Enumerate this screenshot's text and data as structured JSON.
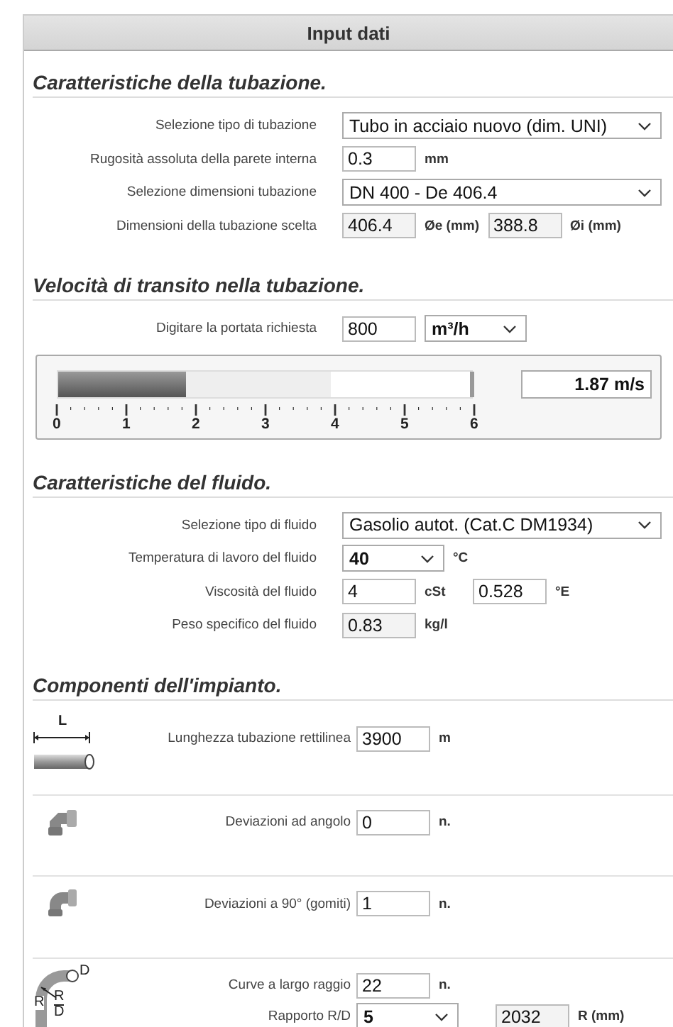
{
  "header": {
    "title": "Input dati"
  },
  "pipe": {
    "title": "Caratteristiche della tubazione.",
    "rows": [
      {
        "label": "Selezione tipo di tubazione",
        "controls": [
          {
            "kind": "select",
            "value": "Tubo in acciaio nuovo (dim. UNI)"
          }
        ]
      },
      {
        "label": "Rugosità assoluta della parete interna",
        "controls": [
          {
            "kind": "input",
            "value": "0.3",
            "disabled": false
          },
          {
            "kind": "unit",
            "text": "mm"
          }
        ]
      },
      {
        "label": "Selezione dimensioni tubazione",
        "controls": [
          {
            "kind": "select",
            "value": "DN 400 - De 406.4"
          }
        ]
      },
      {
        "label": "Dimensioni della tubazione scelta",
        "controls": [
          {
            "kind": "input",
            "value": "406.4",
            "disabled": true
          },
          {
            "kind": "unit",
            "text": "Øe (mm)"
          },
          {
            "kind": "input",
            "value": "388.8",
            "disabled": true
          },
          {
            "kind": "unit",
            "text": "Øi (mm)"
          }
        ]
      }
    ]
  },
  "velocity": {
    "title": "Velocità di transito nella tubazione.",
    "rows": [
      {
        "label": "Digitare la portata richiesta",
        "controls": [
          {
            "kind": "input",
            "value": "800",
            "disabled": false
          },
          {
            "kind": "compact-select",
            "value": "m³/h"
          }
        ]
      }
    ],
    "gauge": {
      "level": 0.31,
      "reading": "1.87 m/s",
      "ticks": [
        "0",
        "1",
        "2",
        "3",
        "4",
        "5",
        "6"
      ]
    }
  },
  "fluid": {
    "title": "Caratteristiche del fluido.",
    "rows": [
      {
        "label": "Selezione tipo di fluido",
        "controls": [
          {
            "kind": "select",
            "value": "Gasolio autot. (Cat.C DM1934)"
          }
        ]
      },
      {
        "label": "Temperatura di lavoro del fluido",
        "controls": [
          {
            "kind": "compact-select",
            "value": "40"
          },
          {
            "kind": "unit",
            "text": "°C"
          }
        ]
      },
      {
        "label": "Viscosità del fluido",
        "controls": [
          {
            "kind": "input",
            "value": "4",
            "disabled": false
          },
          {
            "kind": "unit",
            "text": "cSt"
          },
          {
            "kind": "input",
            "value": "0.528",
            "disabled": false
          },
          {
            "kind": "unit",
            "text": "°E"
          }
        ]
      },
      {
        "label": "Peso specifico del fluido",
        "controls": [
          {
            "kind": "input",
            "value": "0.83",
            "disabled": true
          },
          {
            "kind": "unit",
            "text": "kg/l"
          }
        ]
      }
    ]
  },
  "components": {
    "title": "Componenti dell'impianto.",
    "groups": [
      {
        "kind": "straight-pipe",
        "icon_texts": [
          "L"
        ],
        "rows": [
          {
            "label": "Lunghezza tubazione rettilinea",
            "controls": [
              {
                "kind": "input",
                "value": "3900",
                "disabled": false
              },
              {
                "kind": "unit",
                "text": "m"
              }
            ]
          }
        ]
      },
      {
        "kind": "angle-fitting",
        "rows": [
          {
            "label": "Deviazioni ad angolo",
            "controls": [
              {
                "kind": "input",
                "value": "0",
                "disabled": false
              },
              {
                "kind": "unit",
                "text": "n."
              }
            ]
          }
        ]
      },
      {
        "kind": "elbow",
        "rows": [
          {
            "label": "Deviazioni a 90° (gomiti)",
            "controls": [
              {
                "kind": "input",
                "value": "1",
                "disabled": false
              },
              {
                "kind": "unit",
                "text": "n."
              }
            ]
          }
        ]
      },
      {
        "kind": "bend",
        "icon_texts": [
          "D",
          "R",
          "R",
          "D"
        ],
        "rows": [
          {
            "label": "Curve a largo raggio",
            "controls": [
              {
                "kind": "input",
                "value": "22",
                "disabled": false
              },
              {
                "kind": "unit",
                "text": "n."
              }
            ]
          },
          {
            "label": "Rapporto R/D",
            "controls": [
              {
                "kind": "compact-select",
                "value": "5"
              },
              {
                "kind": "spacer"
              },
              {
                "kind": "input",
                "value": "2032",
                "disabled": true
              },
              {
                "kind": "unit",
                "text": "R (mm)"
              }
            ]
          }
        ]
      }
    ]
  }
}
